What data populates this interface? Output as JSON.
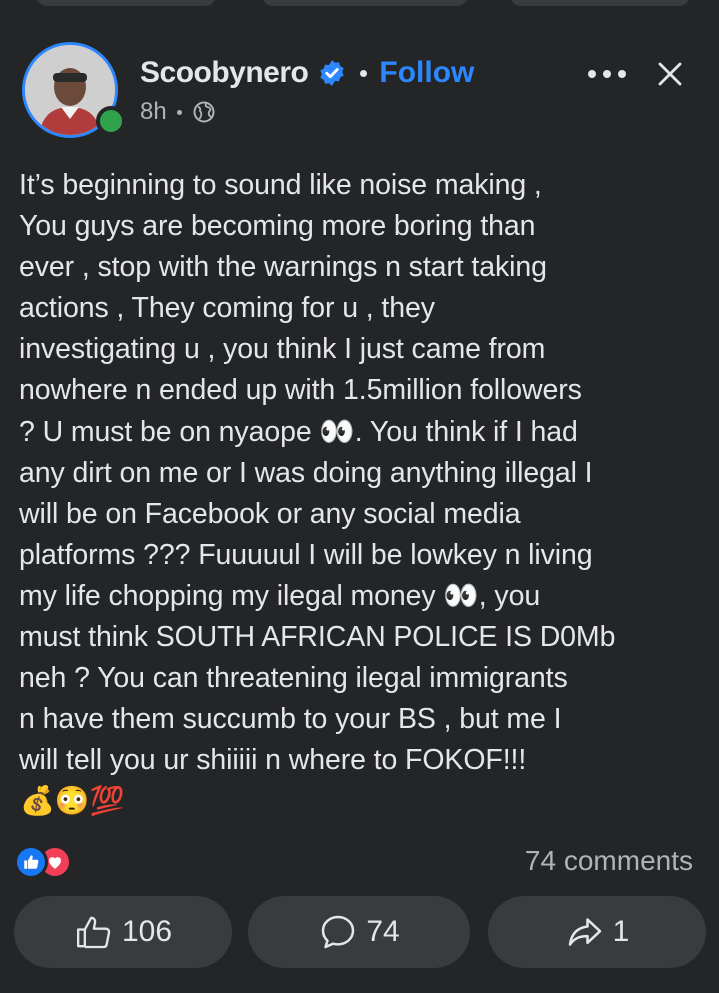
{
  "post": {
    "author": "Scoobynero",
    "follow_label": "Follow",
    "time": "8h",
    "text": "It’s beginning to sound like noise making ,\nYou guys are becoming more boring than\never , stop with the warnings n start taking\nactions , They coming for u , they\ninvestigating u , you think I just came from\nnowhere n ended up with 1.5million followers\n? U must be on nyaope 👀. You think if I had\nany dirt on me or I was doing anything illegal I\nwill be on Facebook or any social media\nplatforms ??? Fuuuuul I will be lowkey n living\nmy life chopping my ilegal money 👀, you\nmust think SOUTH AFRICAN POLICE IS D0Mb\nneh ?  You can threatening ilegal immigrants\nn have them succumb to your BS , but me I\nwill tell you ur shiiiii n where to FOKOF!!!",
    "trailing_emojis": "💰😳💯"
  },
  "engagement": {
    "comments_summary": "74 comments",
    "like_count": "106",
    "comment_count": "74",
    "share_count": "1"
  },
  "colors": {
    "background": "#18191a",
    "card": "#242526",
    "accent": "#2d88ff",
    "online": "#31a24c",
    "text": "#e4e6eb",
    "secondary_text": "#b0b3b8",
    "button": "#3a3b3c"
  },
  "icons": {
    "verified": "verified-badge-icon",
    "privacy": "globe-icon",
    "more": "more-dots-icon",
    "close": "close-icon",
    "like": "thumbs-up-icon",
    "comment": "comment-bubble-icon",
    "share": "share-arrow-icon"
  }
}
